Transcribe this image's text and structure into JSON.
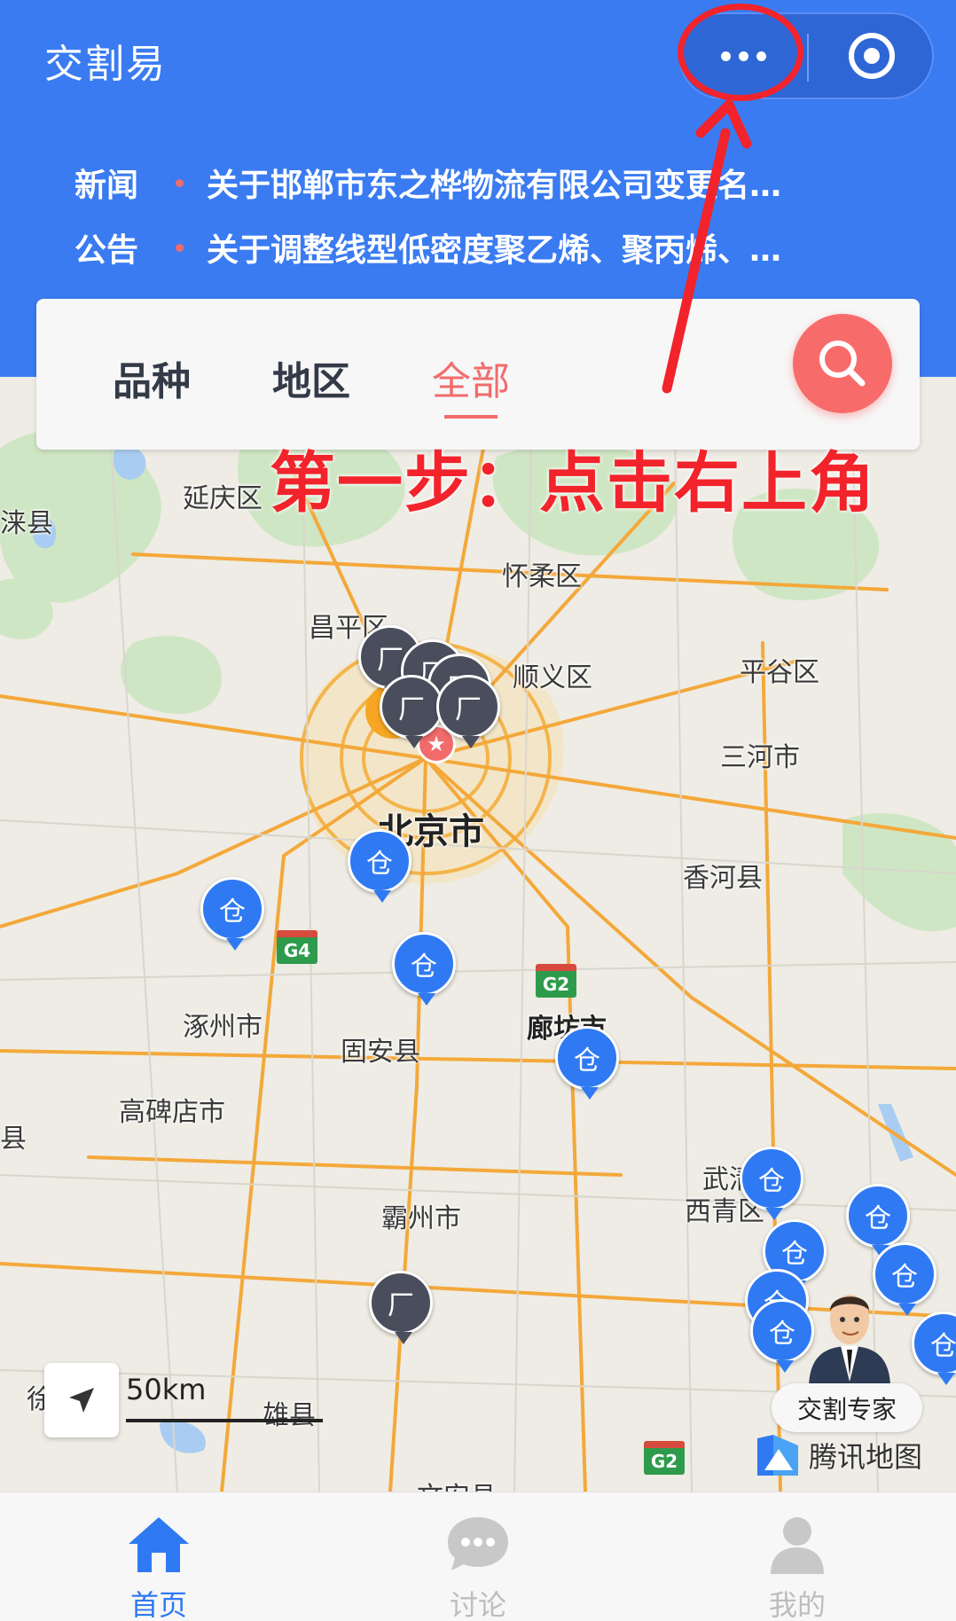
{
  "app": {
    "title": "交割易"
  },
  "capsule": {
    "more_icon": "more-dots-icon",
    "close_icon": "target-circle-icon"
  },
  "news": [
    {
      "tag": "新闻",
      "text": "关于邯郸市东之桦物流有限公司变更名…"
    },
    {
      "tag": "公告",
      "text": "关于调整线型低密度聚乙烯、聚丙烯、…"
    }
  ],
  "filter": {
    "tabs": [
      {
        "label": "品种",
        "active": false
      },
      {
        "label": "地区",
        "active": false
      },
      {
        "label": "全部",
        "active": true
      }
    ],
    "search_icon": "search-icon"
  },
  "annotation": {
    "text": "第一步：点击右上角",
    "color": "#f2232b"
  },
  "map": {
    "places": [
      "延庆区",
      "怀柔区",
      "昌平区",
      "顺义区",
      "平谷区",
      "三河市",
      "北京市",
      "香河县",
      "涿州市",
      "固安县",
      "廊坊市",
      "高碑店市",
      "霸州市",
      "西青区",
      "武清",
      "雄县",
      "涞县",
      "县",
      "徐",
      "文安县"
    ],
    "pin_labels": {
      "warehouse": "仓",
      "factory": "厂"
    },
    "highways": [
      "G4",
      "G2",
      "G2"
    ],
    "scale": "50km",
    "expert_label": "交割专家",
    "provider": "腾讯地图"
  },
  "bottom_nav": [
    {
      "label": "首页",
      "icon": "home-icon",
      "active": true
    },
    {
      "label": "讨论",
      "icon": "chat-bubble-icon",
      "active": false
    },
    {
      "label": "我的",
      "icon": "user-icon",
      "active": false
    }
  ],
  "colors": {
    "brand": "#3a7bf2",
    "accent": "#f26b6b",
    "pin": "#2f7af3",
    "factory_pin": "#4a4e5c"
  }
}
